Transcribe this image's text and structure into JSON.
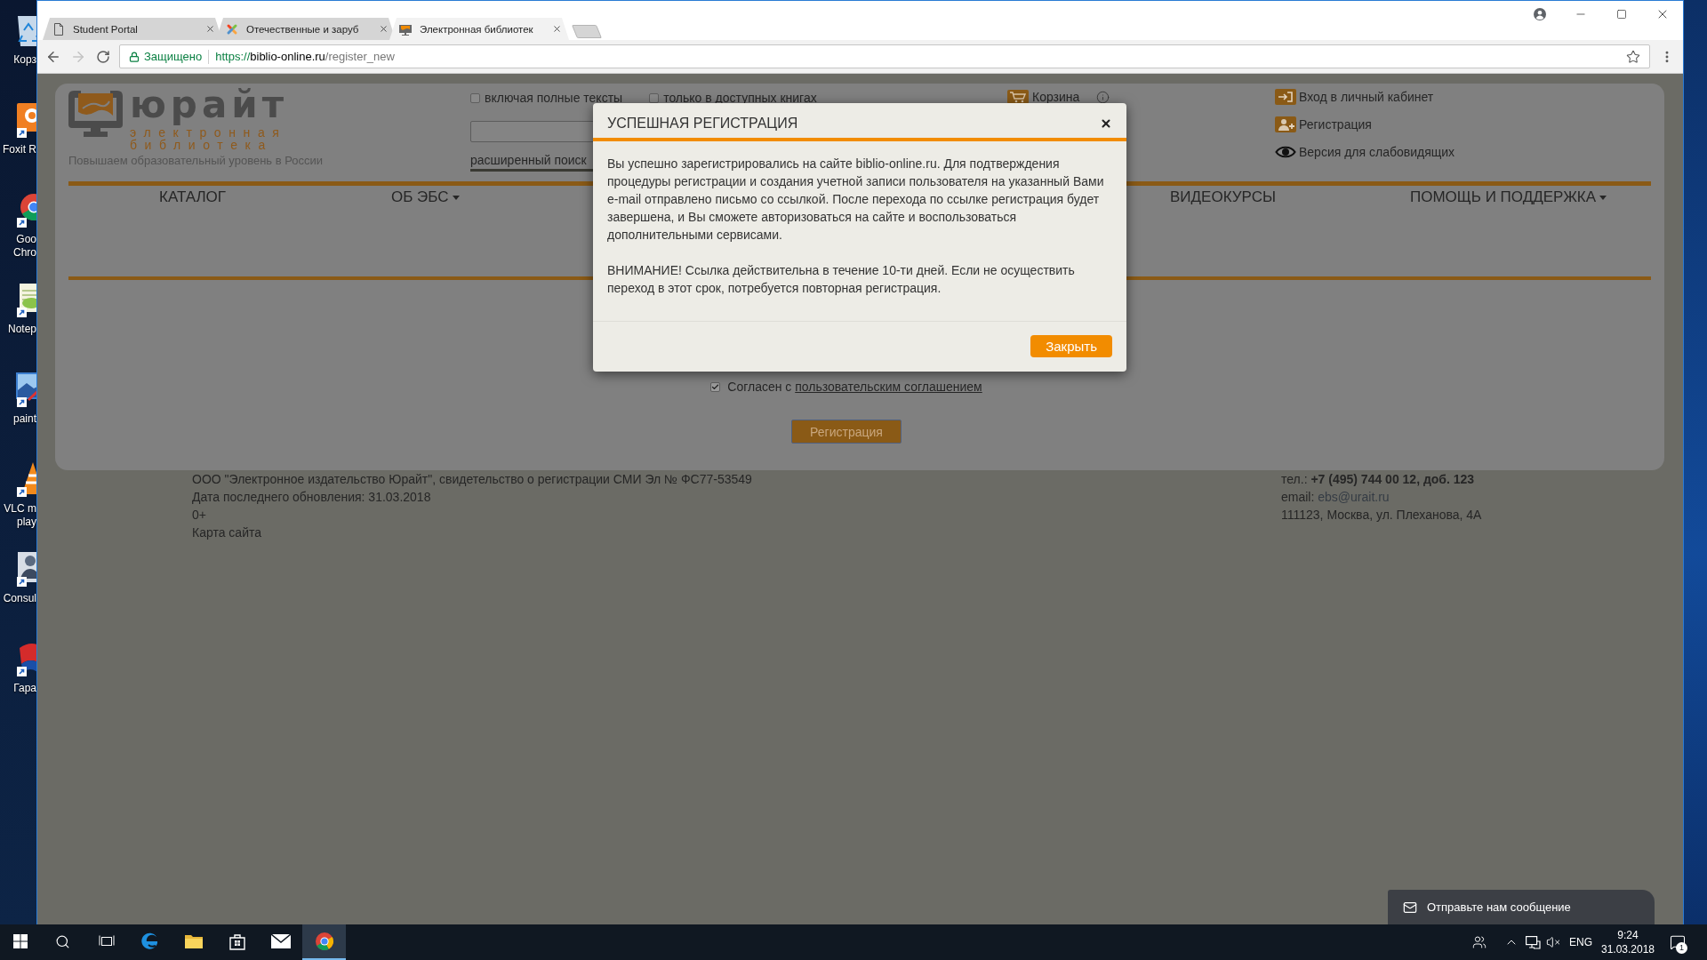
{
  "desktop": {
    "icons": [
      {
        "kind": "recycle-bin",
        "lines": [
          "Корз"
        ]
      },
      {
        "kind": "pdf-reader",
        "lines": [
          "Foxit R"
        ]
      },
      {
        "kind": "chrome",
        "lines": [
          "Goo",
          "Chro"
        ]
      },
      {
        "kind": "notepad",
        "lines": [
          "Notep"
        ]
      },
      {
        "kind": "paint",
        "lines": [
          "paint"
        ]
      },
      {
        "kind": "vlc",
        "lines": [
          "VLC m",
          "play"
        ]
      },
      {
        "kind": "consultant",
        "lines": [
          "Consul"
        ]
      },
      {
        "kind": "garant",
        "lines": [
          "Гара"
        ]
      }
    ]
  },
  "browser": {
    "tabs": [
      {
        "kind": "page",
        "title": "Student Portal",
        "selected": false
      },
      {
        "kind": "joomla",
        "title": "Отечественные и заруб",
        "selected": false
      },
      {
        "kind": "urait",
        "title": "Электронная библиотек",
        "selected": true
      }
    ],
    "nav_buttons": [
      {
        "kind": "back",
        "disabled": false
      },
      {
        "kind": "forward",
        "disabled": true
      },
      {
        "kind": "reload",
        "disabled": false
      }
    ],
    "address": {
      "secure_label": "Защищено",
      "scheme": "https://",
      "host": "biblio-online.ru",
      "path": "/register_new"
    }
  },
  "site": {
    "logo": {
      "wordmark": "юрайт",
      "subtitle_lines": [
        "электронная",
        "библиотека"
      ],
      "tagline": "Повышаем образовательный уровень в России"
    },
    "search": {
      "options": [
        {
          "label": "включая полные тексты",
          "checked": false
        },
        {
          "label": "только в доступных книгах",
          "checked": false
        }
      ],
      "advanced_link": "расширенный поиск"
    },
    "cart": {
      "label": "Корзина"
    },
    "user_links": [
      {
        "kind": "login",
        "label": "Вход в личный кабинет"
      },
      {
        "kind": "register",
        "label": "Регистрация"
      },
      {
        "kind": "accessibility",
        "label": "Версия для слабовидящих"
      }
    ],
    "nav": [
      {
        "label": "КАТАЛОГ",
        "dropdown": false
      },
      {
        "label": "ОБ ЭБС",
        "dropdown": true
      },
      {
        "label": "ВИДЕОКУРСЫ",
        "dropdown": false
      },
      {
        "label": "ПОМОЩЬ И ПОДДЕРЖКА",
        "dropdown": true
      }
    ],
    "form": {
      "agreement": {
        "checked": true,
        "text": "Согласен с",
        "link": "пользовательским соглашением"
      },
      "submit_button": "Регистрация"
    },
    "footer": {
      "left_lines": [
        "ООО \"Электронное издательство Юрайт\", свидетельство о регистрации СМИ Эл № ФС77-53549",
        "Дата последнего обновления: 31.03.2018",
        "0+"
      ],
      "sitemap_link": "Карта сайта",
      "phone": "тел.: **+7 (495) 744 00 12, доб. 123**",
      "email_label": "email:",
      "email": "ebs@urait.ru",
      "address": "111123, Москва, ул. Плеханова, 4А"
    }
  },
  "modal": {
    "title": "УСПЕШНАЯ РЕГИСТРАЦИЯ",
    "paragraphs": [
      "Вы успешно зарегистрировались на сайте biblio-online.ru. Для подтверждения процедуры регистрации и создания учетной записи пользователя на указанный Вами e-mail отправлено письмо со ссылкой. После перехода по ссылке регистрация будет завершена, и Вы сможете авторизоваться на сайте и воспользоваться дополнительными сервисами.",
      "ВНИМАНИЕ! Ссылка действительна в течение 10-ти дней. Если не осуществить переход в этот срок, потребуется повторная регистрация."
    ],
    "close_button": "Закрыть"
  },
  "chat_widget": {
    "label": "Отправьте нам сообщение"
  },
  "taskbar": {
    "apps": [
      {
        "kind": "start",
        "active": false
      },
      {
        "kind": "search",
        "active": false
      },
      {
        "kind": "task-view",
        "active": false
      },
      {
        "kind": "edge",
        "active": false
      },
      {
        "kind": "explorer",
        "active": false
      },
      {
        "kind": "store",
        "active": false
      },
      {
        "kind": "mail",
        "active": false
      },
      {
        "kind": "chrome",
        "active": true
      }
    ],
    "language": "ENG",
    "time": "9:24",
    "date": "31.03.2018",
    "notification_count": "1"
  }
}
